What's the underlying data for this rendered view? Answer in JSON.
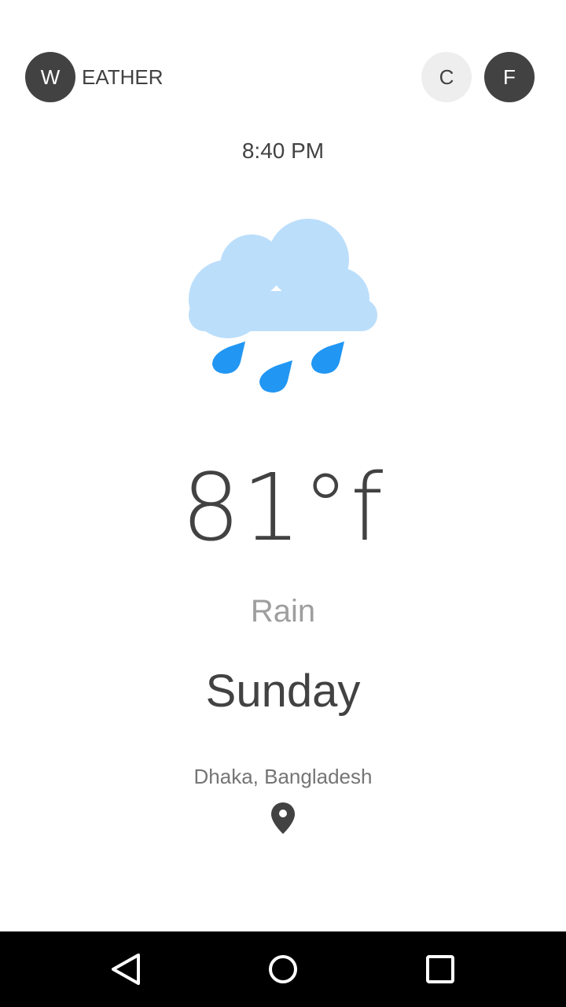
{
  "header": {
    "logo_letter": "W",
    "logo_text": "EATHER",
    "unit_c_label": "C",
    "unit_f_label": "F",
    "selected_unit": "F"
  },
  "weather": {
    "time": "8:40 PM",
    "icon": "rain-cloud-icon",
    "temperature": "81°f",
    "condition": "Rain",
    "day": "Sunday",
    "location": "Dhaka, Bangladesh",
    "location_icon": "location-pin-icon"
  },
  "colors": {
    "primary_dark": "#424242",
    "inactive_unit_bg": "#eeeeee",
    "cloud": "#bbdefb",
    "rain_drop": "#2196f3",
    "nav_bar": "#000000"
  },
  "nav_bar": {
    "back_icon": "back-triangle-icon",
    "home_icon": "home-circle-icon",
    "recents_icon": "recents-square-icon"
  }
}
